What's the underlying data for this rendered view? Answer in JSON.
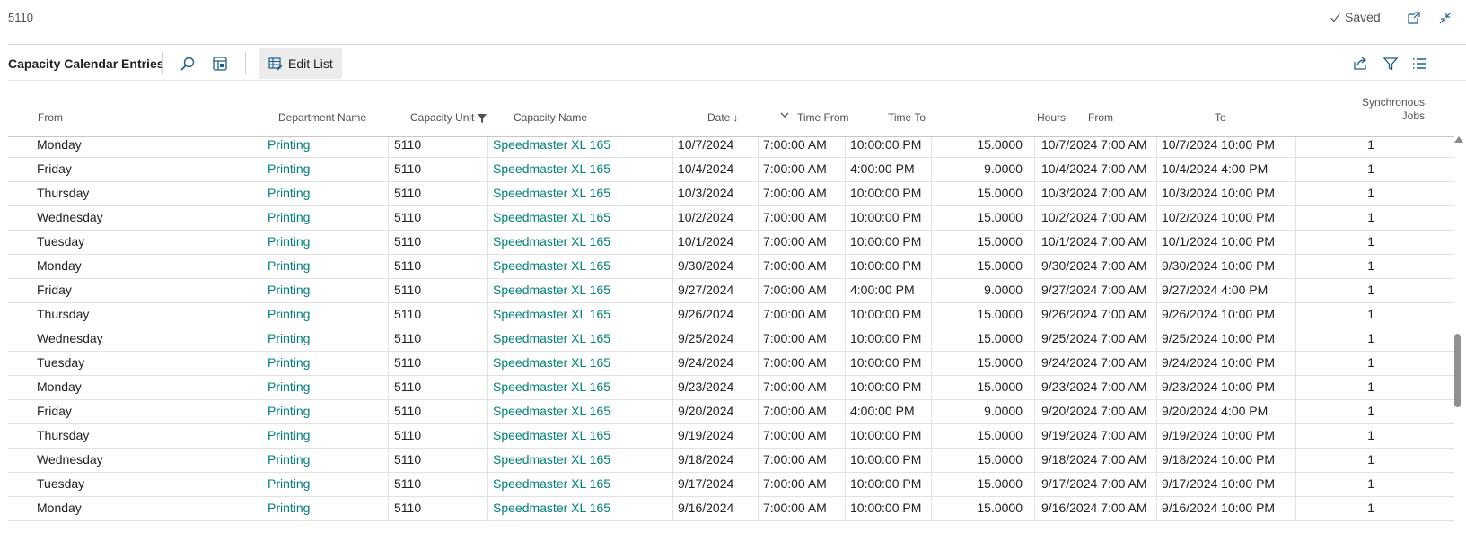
{
  "topbar": {
    "page_id": "5110",
    "saved_label": "Saved",
    "icons": [
      "open-new-window-icon",
      "collapse-icon"
    ]
  },
  "actionbar": {
    "caption": "Capacity Calendar Entries",
    "edit_list_label": "Edit List",
    "icons": [
      "search-icon",
      "filter-pane-icon",
      "share-icon",
      "filter-icon",
      "list-view-icon"
    ]
  },
  "columns": {
    "from_weekday": "From",
    "department_name": "Department Name",
    "capacity_unit": "Capacity Unit",
    "capacity_name": "Capacity Name",
    "date": "Date",
    "date_sort": "↓",
    "time_from": "Time From",
    "time_to": "Time To",
    "hours": "Hours",
    "from_datetime": "From",
    "to_datetime": "To",
    "synchronous_jobs_line1": "Synchronous",
    "synchronous_jobs_line2": "Jobs"
  },
  "rows": [
    {
      "day": "Monday",
      "dept": "Printing",
      "unit": "5110",
      "cap": "Speedmaster XL 165",
      "date": "10/7/2024",
      "tfrom": "7:00:00 AM",
      "tto": "10:00:00 PM",
      "hours": "15.0000",
      "from": "10/7/2024 7:00 AM",
      "to": "10/7/2024 10:00 PM",
      "jobs": "1"
    },
    {
      "day": "Friday",
      "dept": "Printing",
      "unit": "5110",
      "cap": "Speedmaster XL 165",
      "date": "10/4/2024",
      "tfrom": "7:00:00 AM",
      "tto": "4:00:00 PM",
      "hours": "9.0000",
      "from": "10/4/2024 7:00 AM",
      "to": "10/4/2024 4:00 PM",
      "jobs": "1"
    },
    {
      "day": "Thursday",
      "dept": "Printing",
      "unit": "5110",
      "cap": "Speedmaster XL 165",
      "date": "10/3/2024",
      "tfrom": "7:00:00 AM",
      "tto": "10:00:00 PM",
      "hours": "15.0000",
      "from": "10/3/2024 7:00 AM",
      "to": "10/3/2024 10:00 PM",
      "jobs": "1"
    },
    {
      "day": "Wednesday",
      "dept": "Printing",
      "unit": "5110",
      "cap": "Speedmaster XL 165",
      "date": "10/2/2024",
      "tfrom": "7:00:00 AM",
      "tto": "10:00:00 PM",
      "hours": "15.0000",
      "from": "10/2/2024 7:00 AM",
      "to": "10/2/2024 10:00 PM",
      "jobs": "1"
    },
    {
      "day": "Tuesday",
      "dept": "Printing",
      "unit": "5110",
      "cap": "Speedmaster XL 165",
      "date": "10/1/2024",
      "tfrom": "7:00:00 AM",
      "tto": "10:00:00 PM",
      "hours": "15.0000",
      "from": "10/1/2024 7:00 AM",
      "to": "10/1/2024 10:00 PM",
      "jobs": "1"
    },
    {
      "day": "Monday",
      "dept": "Printing",
      "unit": "5110",
      "cap": "Speedmaster XL 165",
      "date": "9/30/2024",
      "tfrom": "7:00:00 AM",
      "tto": "10:00:00 PM",
      "hours": "15.0000",
      "from": "9/30/2024 7:00 AM",
      "to": "9/30/2024 10:00 PM",
      "jobs": "1"
    },
    {
      "day": "Friday",
      "dept": "Printing",
      "unit": "5110",
      "cap": "Speedmaster XL 165",
      "date": "9/27/2024",
      "tfrom": "7:00:00 AM",
      "tto": "4:00:00 PM",
      "hours": "9.0000",
      "from": "9/27/2024 7:00 AM",
      "to": "9/27/2024 4:00 PM",
      "jobs": "1"
    },
    {
      "day": "Thursday",
      "dept": "Printing",
      "unit": "5110",
      "cap": "Speedmaster XL 165",
      "date": "9/26/2024",
      "tfrom": "7:00:00 AM",
      "tto": "10:00:00 PM",
      "hours": "15.0000",
      "from": "9/26/2024 7:00 AM",
      "to": "9/26/2024 10:00 PM",
      "jobs": "1"
    },
    {
      "day": "Wednesday",
      "dept": "Printing",
      "unit": "5110",
      "cap": "Speedmaster XL 165",
      "date": "9/25/2024",
      "tfrom": "7:00:00 AM",
      "tto": "10:00:00 PM",
      "hours": "15.0000",
      "from": "9/25/2024 7:00 AM",
      "to": "9/25/2024 10:00 PM",
      "jobs": "1"
    },
    {
      "day": "Tuesday",
      "dept": "Printing",
      "unit": "5110",
      "cap": "Speedmaster XL 165",
      "date": "9/24/2024",
      "tfrom": "7:00:00 AM",
      "tto": "10:00:00 PM",
      "hours": "15.0000",
      "from": "9/24/2024 7:00 AM",
      "to": "9/24/2024 10:00 PM",
      "jobs": "1"
    },
    {
      "day": "Monday",
      "dept": "Printing",
      "unit": "5110",
      "cap": "Speedmaster XL 165",
      "date": "9/23/2024",
      "tfrom": "7:00:00 AM",
      "tto": "10:00:00 PM",
      "hours": "15.0000",
      "from": "9/23/2024 7:00 AM",
      "to": "9/23/2024 10:00 PM",
      "jobs": "1"
    },
    {
      "day": "Friday",
      "dept": "Printing",
      "unit": "5110",
      "cap": "Speedmaster XL 165",
      "date": "9/20/2024",
      "tfrom": "7:00:00 AM",
      "tto": "4:00:00 PM",
      "hours": "9.0000",
      "from": "9/20/2024 7:00 AM",
      "to": "9/20/2024 4:00 PM",
      "jobs": "1"
    },
    {
      "day": "Thursday",
      "dept": "Printing",
      "unit": "5110",
      "cap": "Speedmaster XL 165",
      "date": "9/19/2024",
      "tfrom": "7:00:00 AM",
      "tto": "10:00:00 PM",
      "hours": "15.0000",
      "from": "9/19/2024 7:00 AM",
      "to": "9/19/2024 10:00 PM",
      "jobs": "1"
    },
    {
      "day": "Wednesday",
      "dept": "Printing",
      "unit": "5110",
      "cap": "Speedmaster XL 165",
      "date": "9/18/2024",
      "tfrom": "7:00:00 AM",
      "tto": "10:00:00 PM",
      "hours": "15.0000",
      "from": "9/18/2024 7:00 AM",
      "to": "9/18/2024 10:00 PM",
      "jobs": "1"
    },
    {
      "day": "Tuesday",
      "dept": "Printing",
      "unit": "5110",
      "cap": "Speedmaster XL 165",
      "date": "9/17/2024",
      "tfrom": "7:00:00 AM",
      "tto": "10:00:00 PM",
      "hours": "15.0000",
      "from": "9/17/2024 7:00 AM",
      "to": "9/17/2024 10:00 PM",
      "jobs": "1"
    },
    {
      "day": "Monday",
      "dept": "Printing",
      "unit": "5110",
      "cap": "Speedmaster XL 165",
      "date": "9/16/2024",
      "tfrom": "7:00:00 AM",
      "tto": "10:00:00 PM",
      "hours": "15.0000",
      "from": "9/16/2024 7:00 AM",
      "to": "9/16/2024 10:00 PM",
      "jobs": "1"
    }
  ],
  "colors": {
    "link": "#00807a",
    "text": "#212121",
    "muted": "#505050"
  }
}
